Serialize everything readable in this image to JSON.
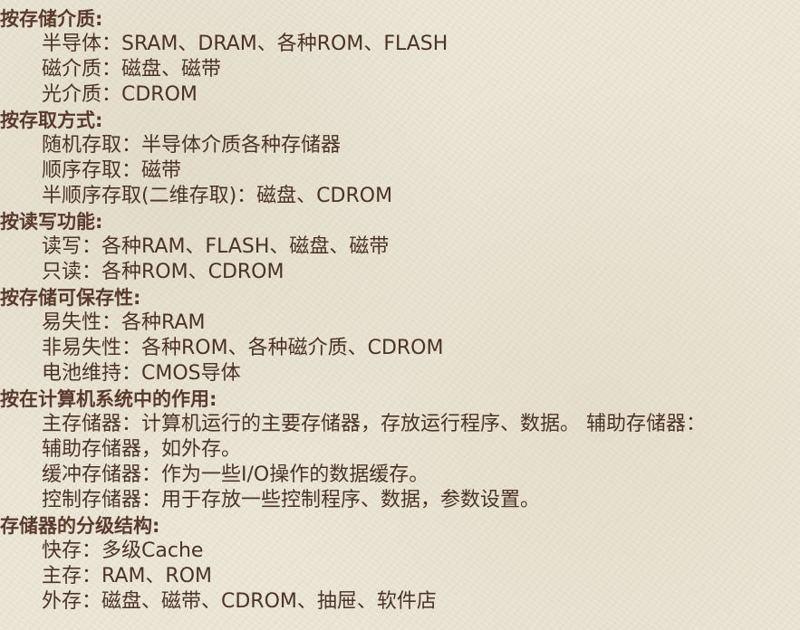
{
  "sections": [
    {
      "heading": "按存储介质:",
      "items": [
        "半导体：SRAM、DRAM、各种ROM、FLASH",
        "磁介质：磁盘、磁带",
        "光介质：CDROM"
      ]
    },
    {
      "heading": "按存取方式:",
      "items": [
        "随机存取：半导体介质各种存储器",
        "顺序存取：磁带",
        "半顺序存取(二维存取)：磁盘、CDROM"
      ]
    },
    {
      "heading": "按读写功能:",
      "items": [
        "读写：各种RAM、FLASH、磁盘、磁带",
        "只读：各种ROM、CDROM"
      ]
    },
    {
      "heading": "按存储可保存性:",
      "items": [
        "易失性：各种RAM",
        "非易失性：各种ROM、各种磁介质、CDROM",
        "电池维持：CMOS导体"
      ]
    },
    {
      "heading": "按在计算机系统中的作用:",
      "items": [
        "主存储器：计算机运行的主要存储器，存放运行程序、数据。 辅助存储器：",
        "辅助存储器，如外存。",
        "缓冲存储器：作为一些I/O操作的数据缓存。",
        "控制存储器：用于存放一些控制程序、数据，参数设置。"
      ]
    },
    {
      "heading": "存储器的分级结构:",
      "items": [
        "快存：多级Cache",
        "主存：RAM、ROM",
        "外存：磁盘、磁带、CDROM、抽屉、软件店"
      ]
    }
  ],
  "colors": {
    "background": "#ece6d8",
    "heading_text": "#5a3a2b",
    "item_text": "#4b3328"
  }
}
